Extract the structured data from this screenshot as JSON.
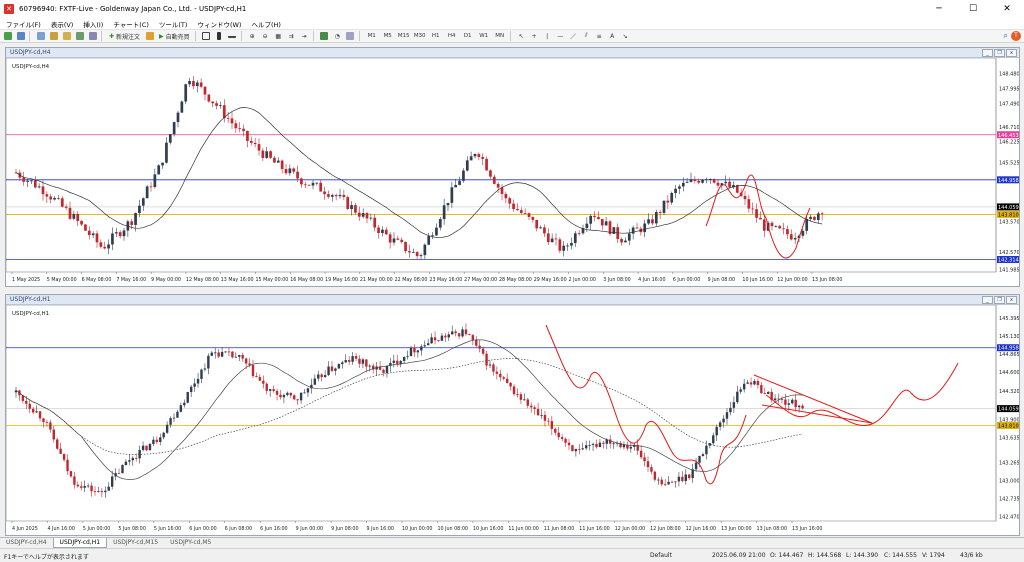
{
  "window": {
    "title": "60796940: FXTF-Live - Goldenway Japan Co., Ltd. - USDJPY-cd,H1",
    "controls": [
      "─",
      "☐",
      "✕"
    ]
  },
  "menu": [
    "ファイル(F)",
    "表示(V)",
    "挿入(I)",
    "チャート(C)",
    "ツール(T)",
    "ウィンドウ(W)",
    "ヘルプ(H)"
  ],
  "toolbar": {
    "new_order": "新規注文",
    "auto_trade": "自動売買",
    "timeframes": [
      "M1",
      "M5",
      "M15",
      "M30",
      "H1",
      "H4",
      "D1",
      "W1",
      "MN"
    ]
  },
  "chart_h4": {
    "title": "USDJPY-cd,H4",
    "inner_label": "USDJPY-cd,H4",
    "price_labels": [
      "148.480",
      "147.995",
      "147.490",
      "146.710",
      "146.225",
      "145.525",
      "144.958",
      "144.035",
      "143.570",
      "142.570",
      "141.985"
    ],
    "level_labels": {
      "magenta": "146.453",
      "blue": "144.958",
      "yellow": "143.810",
      "bid": "144.059",
      "bottom_blue": "142.314"
    },
    "time_labels": [
      "1 May 2025",
      "5 May 00:00",
      "6 May 08:00",
      "7 May 16:00",
      "9 May 00:00",
      "12 May 08:00",
      "13 May 16:00",
      "15 May 00:00",
      "16 May 08:00",
      "19 May 16:00",
      "21 May 00:00",
      "22 May 08:00",
      "23 May 16:00",
      "27 May 00:00",
      "28 May 08:00",
      "29 May 16:00",
      "2 Jun 00:00",
      "3 Jun 08:00",
      "4 Jun 16:00",
      "6 Jun 00:00",
      "9 Jun 08:00",
      "10 Jun 16:00",
      "12 Jun 00:00",
      "13 Jun 08:00"
    ]
  },
  "chart_h1": {
    "title": "USDJPY-cd,H1",
    "inner_label": "USDJPY-cd,H1",
    "price_labels": [
      "145.395",
      "145.130",
      "144.865",
      "144.600",
      "144.320",
      "143.900",
      "143.635",
      "143.265",
      "143.000",
      "142.735",
      "142.470"
    ],
    "level_labels": {
      "blue": "144.958",
      "yellow": "143.810",
      "bid": "144.059"
    },
    "time_labels": [
      "4 Jun 2025",
      "4 Jun 16:00",
      "5 Jun 00:00",
      "5 Jun 08:00",
      "5 Jun 16:00",
      "6 Jun 00:00",
      "6 Jun 08:00",
      "6 Jun 16:00",
      "9 Jun 00:00",
      "9 Jun 08:00",
      "9 Jun 16:00",
      "10 Jun 00:00",
      "10 Jun 08:00",
      "10 Jun 16:00",
      "11 Jun 00:00",
      "11 Jun 08:00",
      "11 Jun 16:00",
      "12 Jun 00:00",
      "12 Jun 08:00",
      "12 Jun 16:00",
      "13 Jun 00:00",
      "13 Jun 08:00",
      "13 Jun 16:00"
    ]
  },
  "tabs": [
    "USDJPY-cd,H4",
    "USDJPY-cd,H1",
    "USDJPY-cd,M15",
    "USDJPY-cd,M5"
  ],
  "active_tab": 1,
  "status": {
    "help": "F1キーでヘルプが表示されます",
    "profile": "Default",
    "datetime": "2025.06.09 21:00",
    "open": "O: 144.467",
    "high": "H: 144.568",
    "low": "L: 144.390",
    "close": "C: 144.555",
    "volume": "V: 1794",
    "traffic": "43/6 kb"
  },
  "colors": {
    "bull": "#2e3d4f",
    "bear": "#c1272d",
    "blue_line": "#1f35c8",
    "magenta_line": "#e0409a",
    "yellow_line": "#e0b400",
    "drawing": "#e21b1b"
  }
}
